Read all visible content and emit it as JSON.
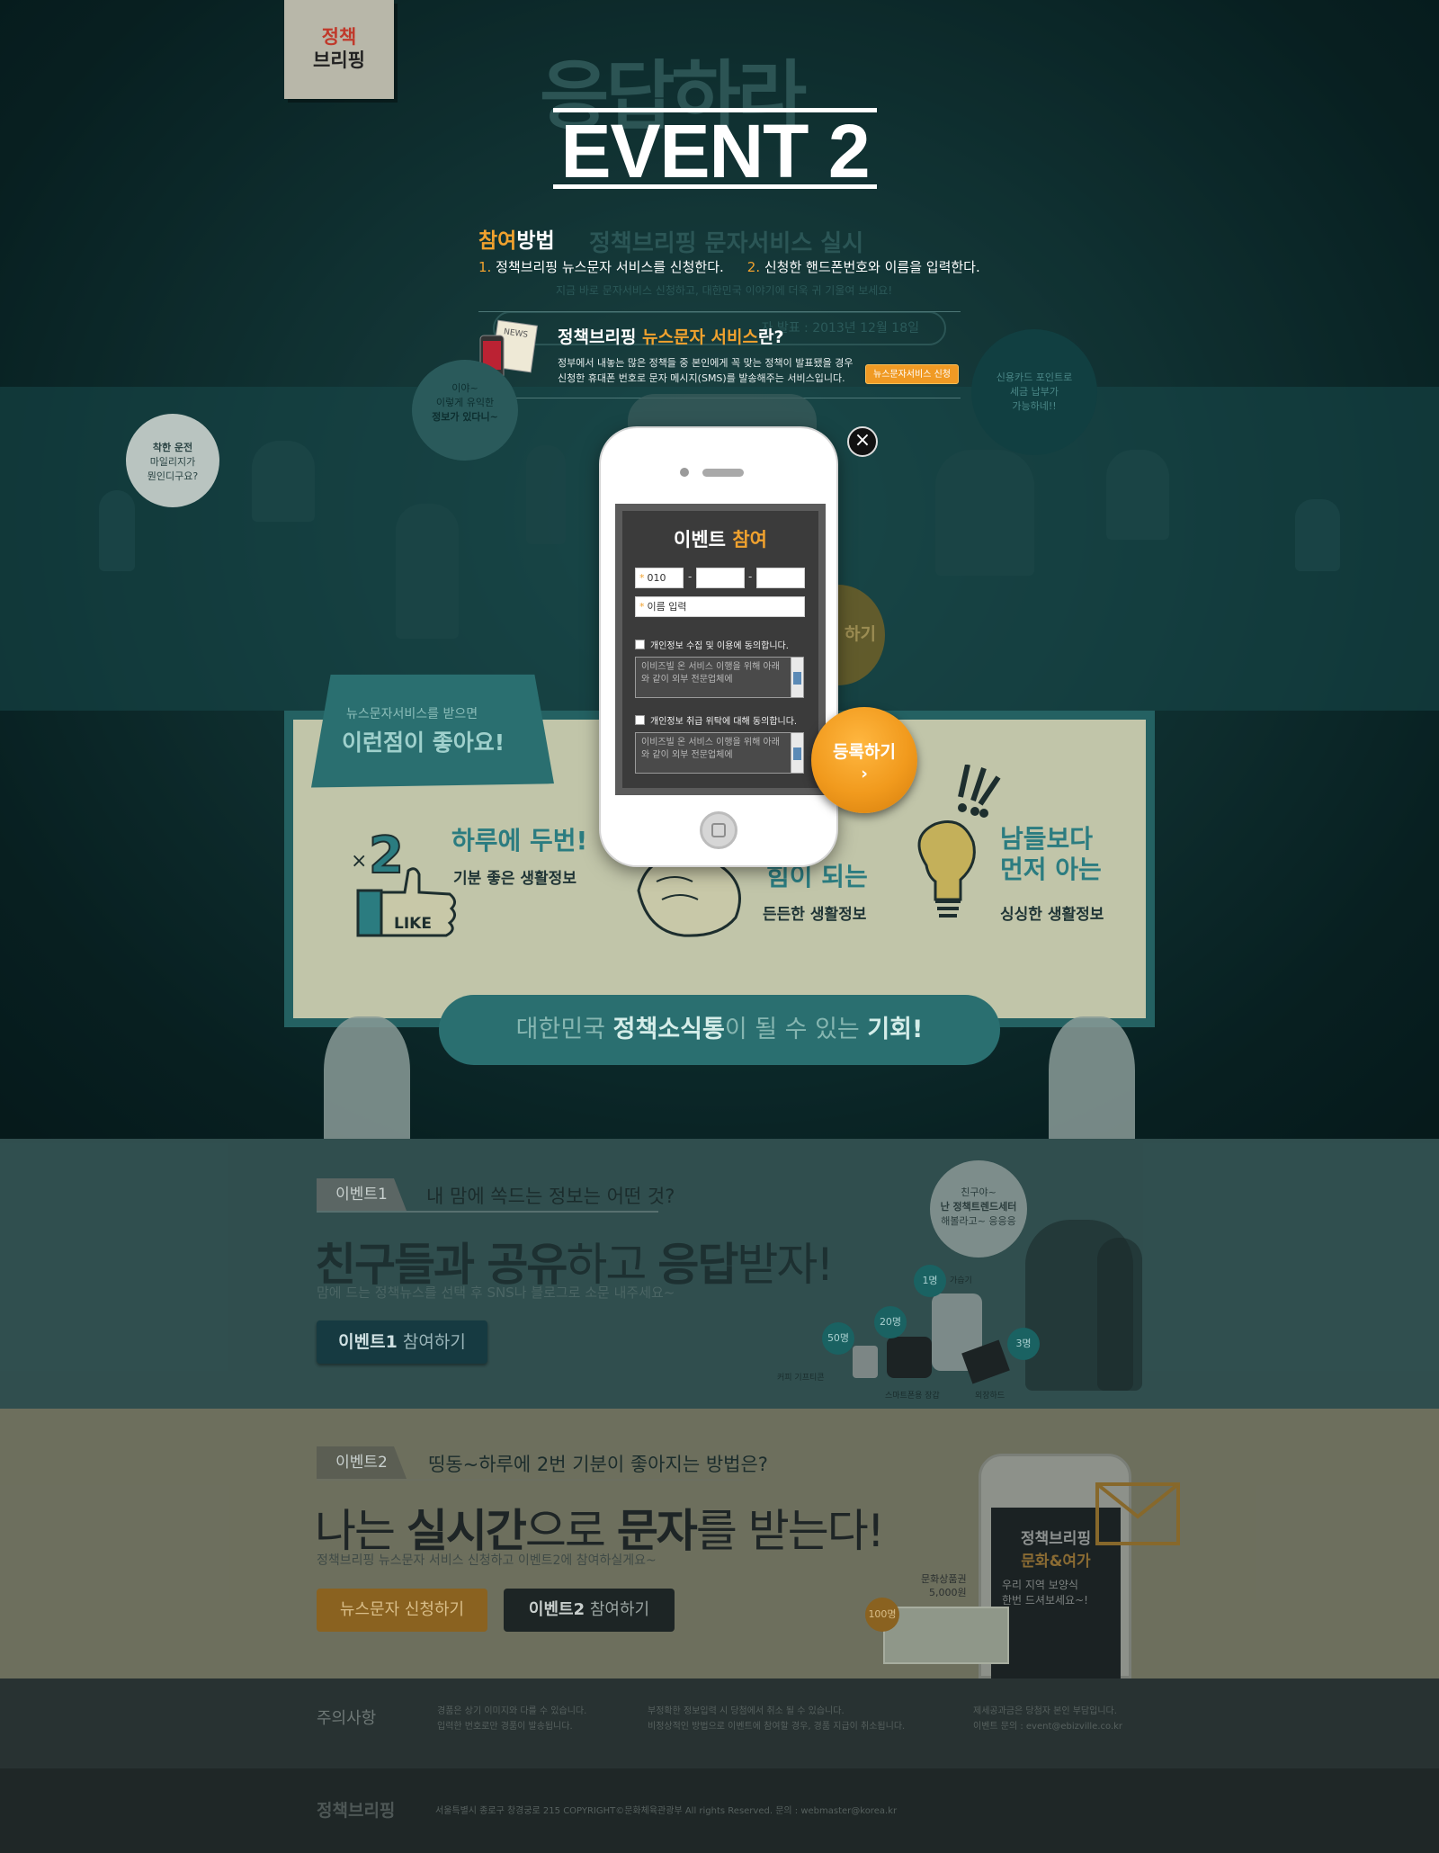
{
  "logo": {
    "line1": "정책",
    "line2": "브리핑"
  },
  "hero": {
    "bg_title": "응답하라",
    "event_title": "EVENT 2",
    "how_hl": "참여",
    "how_rest": "방법",
    "service_title": "정책브리핑 문자서비스 실시",
    "steps": [
      {
        "num": "1.",
        "text": "정책브리핑 뉴스문자 서비스를 신청한다."
      },
      {
        "num": "2.",
        "text": "신청한 핸드폰번호와 이름을 입력한다."
      }
    ],
    "faint_line": "지금 바로 문자서비스 신청하고, 대한민국 이야기에 더욱 귀 기울여 보세요!",
    "date_text": "자 발표 : 2013년 12월 18일",
    "news_title_a": "정책브리핑 ",
    "news_title_hl": "뉴스문자 서비스",
    "news_title_b": "란?",
    "news_desc1": "정부에서 내놓는 많은 정책들 중 본인에게 꼭 맞는 정책이 발표됐을 경우",
    "news_desc2": "신청한 휴대폰 번호로 문자 메시지(SMS)를 발송해주는 서비스입니다.",
    "news_btn": "뉴스문자서비스 신청"
  },
  "bubbles": {
    "b1": [
      "착한 운전",
      "마일리지가",
      "뭔인디구요?"
    ],
    "b2": [
      "이야~",
      "이렇게 유익한",
      "정보가 있다니~"
    ],
    "b3": [
      "신용카드 포인트로",
      "세금 납부가",
      "가능하네!!"
    ]
  },
  "benefits": {
    "ribbon_sub": "뉴스문자서비스를 받으면",
    "ribbon_main": "이런점이 좋아요!",
    "items": [
      {
        "title1": "하루에 두번!",
        "title2": "",
        "sub": "기분 좋은 생활정보"
      },
      {
        "title1": "힘이 되는",
        "title2": "",
        "sub": "든든한 생활정보"
      },
      {
        "title1": "남들보다",
        "title2": "먼저 아는",
        "sub": "싱싱한 생활정보"
      }
    ],
    "like_label": "LIKE",
    "chance_a": "대한민국 ",
    "chance_b": "정책소식통",
    "chance_c": "이 될 수 있는 ",
    "chance_d": "기회!"
  },
  "modal": {
    "title_a": "이벤트 ",
    "title_hl": "참여",
    "phone1": "010",
    "phone2": "",
    "phone3": "",
    "name_placeholder": "이름 입력",
    "agree1": "개인정보 수집 및 이용에 동의합니다.",
    "terms1": "이비즈빌 온 서비스 이행을 위해 아래와 같이 외부 전문업체에",
    "agree2": "개인정보 취급 위탁에 대해 동의합니다.",
    "terms2": "이비즈빌 온 서비스 이행을 위해 아래와 같이 외부 전문업체에",
    "register_label": "등록하기",
    "register_arrow": "›",
    "close": "×",
    "ghost_register": "하기"
  },
  "event1": {
    "tag": "이벤트1",
    "tagline": "내 맘에 쏙드는 정보는 어떤 것?",
    "head_b1": "친구들과 ",
    "head_b2": "공유",
    "head_n1": "하고 ",
    "head_b3": "응답",
    "head_n2": "받자!",
    "desc": "맘에 드는 정책뉴스를 선택 후 SNS나 블로그로 소문 내주세요~",
    "btn_a": "이벤트1",
    "btn_b": " 참여하기",
    "bubble": [
      "친구야~",
      "난 정책트렌드세터",
      "해볼라고~ 응응응"
    ],
    "prizes": [
      {
        "badge": "1명",
        "label": "가습기"
      },
      {
        "badge": "20명",
        "label": "스마트폰용 장갑"
      },
      {
        "badge": "50명",
        "label": "커피 기프티콘"
      },
      {
        "badge": "3명",
        "label": "외장하드"
      }
    ]
  },
  "event2": {
    "tag": "이벤트2",
    "tagline": "띵동~하루에 2번 기분이 좋아지는 방법은?",
    "head_n1": "나는 ",
    "head_b1": "실시간",
    "head_n2": "으로 ",
    "head_b2": "문자",
    "head_n3": "를 받는다!",
    "desc": "정책브리핑 뉴스문자 서비스 신청하고 이벤트2에 참여하실게요~",
    "btn1": "뉴스문자 신청하기",
    "btn2_a": "이벤트2",
    "btn2_b": " 참여하기",
    "phone_t1": "정책브리핑",
    "phone_t2": "문화&여가",
    "phone_t3": "우리 지역 보양식\n한번 드셔보세요~!",
    "ticket_label1": "문화상품권",
    "ticket_label2": "5,000원",
    "ticket_badge": "100명"
  },
  "notes": {
    "title": "주의사항",
    "col1": [
      "경품은 상기 이미지와 다를 수 있습니다.",
      "입력한 번호로만 경품이 발송됩니다."
    ],
    "col2": [
      "부정확한 정보입력 시 당첨에서 취소 될 수 있습니다.",
      "비정상적인 방법으로 이벤트에 참여할 경우, 경품 지급이 취소됩니다."
    ],
    "col3": [
      "제세공과금은 당첨자 본인 부담입니다.",
      "이벤트 문의 : event@ebizville.co.kr"
    ]
  },
  "footer": {
    "logo": "정책브리핑",
    "text": "서울특별시 종로구 창경궁로 215   COPYRIGHT©문화체육관광부 All rights Reserved.   문의 : webmaster@korea.kr"
  }
}
